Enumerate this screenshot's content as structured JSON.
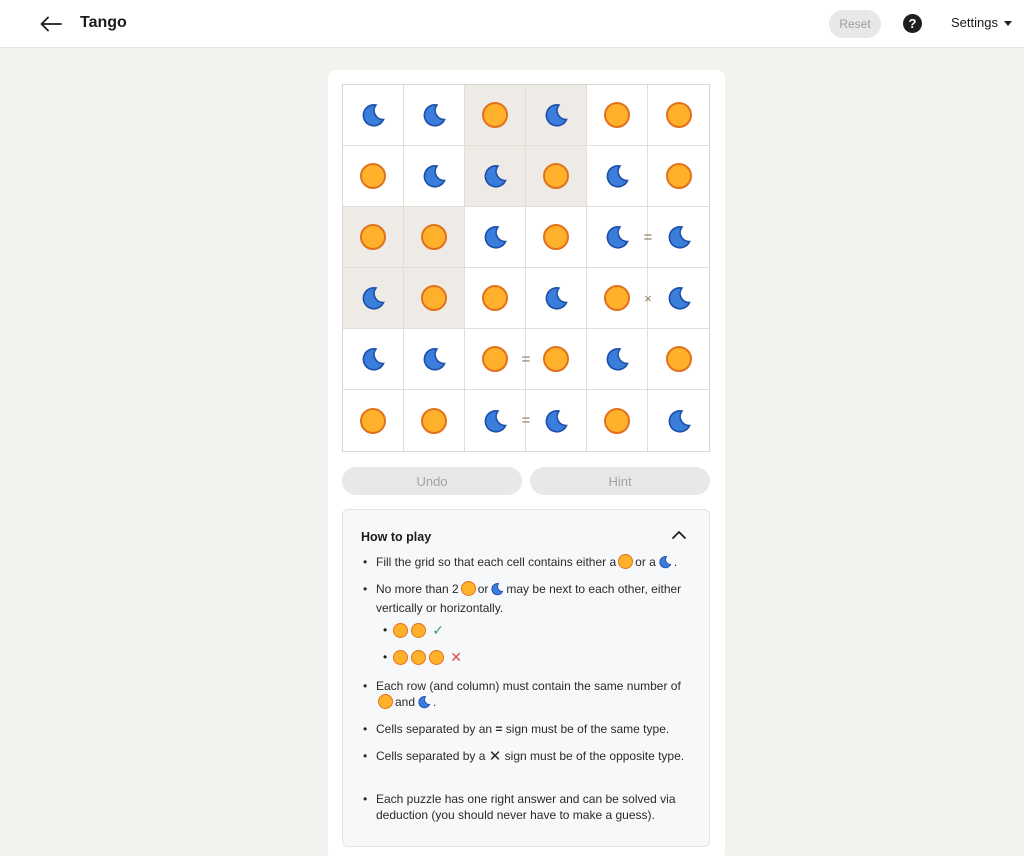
{
  "header": {
    "title": "Tango",
    "reset_label": "Reset",
    "help_label": "?",
    "settings_label": "Settings"
  },
  "board": {
    "rows": [
      [
        "moon",
        "moon",
        "sun",
        "moon",
        "sun",
        "sun"
      ],
      [
        "sun",
        "moon",
        "moon",
        "sun",
        "moon",
        "sun"
      ],
      [
        "sun",
        "sun",
        "moon",
        "sun",
        "moon",
        "moon"
      ],
      [
        "moon",
        "sun",
        "sun",
        "moon",
        "sun",
        "moon"
      ],
      [
        "moon",
        "moon",
        "sun",
        "sun",
        "moon",
        "sun"
      ],
      [
        "sun",
        "sun",
        "moon",
        "moon",
        "sun",
        "moon"
      ]
    ],
    "locked": [
      [
        false,
        false,
        true,
        true,
        false,
        false
      ],
      [
        false,
        false,
        true,
        true,
        false,
        false
      ],
      [
        true,
        true,
        false,
        false,
        false,
        false
      ],
      [
        true,
        true,
        false,
        false,
        false,
        false
      ],
      [
        false,
        false,
        false,
        false,
        false,
        false
      ],
      [
        false,
        false,
        false,
        false,
        false,
        false
      ]
    ],
    "constraints": [
      {
        "row": 2,
        "col": 4,
        "dir": "right",
        "symbol": "="
      },
      {
        "row": 3,
        "col": 4,
        "dir": "right",
        "symbol": "×"
      },
      {
        "row": 4,
        "col": 2,
        "dir": "right",
        "symbol": "="
      },
      {
        "row": 5,
        "col": 2,
        "dir": "right",
        "symbol": "="
      }
    ],
    "colors": {
      "sun_fill": "#ffb12c",
      "sun_stroke": "#e2711d",
      "moon_fill": "#3a7ddb",
      "moon_stroke": "#1c4ea8",
      "locked_bg": "#eeebe6"
    }
  },
  "controls": {
    "undo_label": "Undo",
    "hint_label": "Hint"
  },
  "how_to_play": {
    "title": "How to play",
    "rule1": {
      "a": "Fill the grid so that each cell contains either a",
      "b": "or a",
      "c": "."
    },
    "rule2": {
      "a": "No more than 2",
      "b": "or",
      "c": "may be next to each other, either vertically or horizontally."
    },
    "rule3": {
      "a": "Each row (and column) must contain the same number of",
      "b": "and",
      "c": "."
    },
    "rule4": {
      "a": "Cells separated by an",
      "sign": "=",
      "b": "sign must be of the same type."
    },
    "rule5": {
      "a": "Cells separated by a",
      "sign": "✕",
      "b": "sign must be of the opposite type."
    },
    "rule6": "Each puzzle has one right answer and can be solved via deduction (you should never have to make a guess).",
    "ok_mark": "✓",
    "bad_mark": "✕"
  }
}
